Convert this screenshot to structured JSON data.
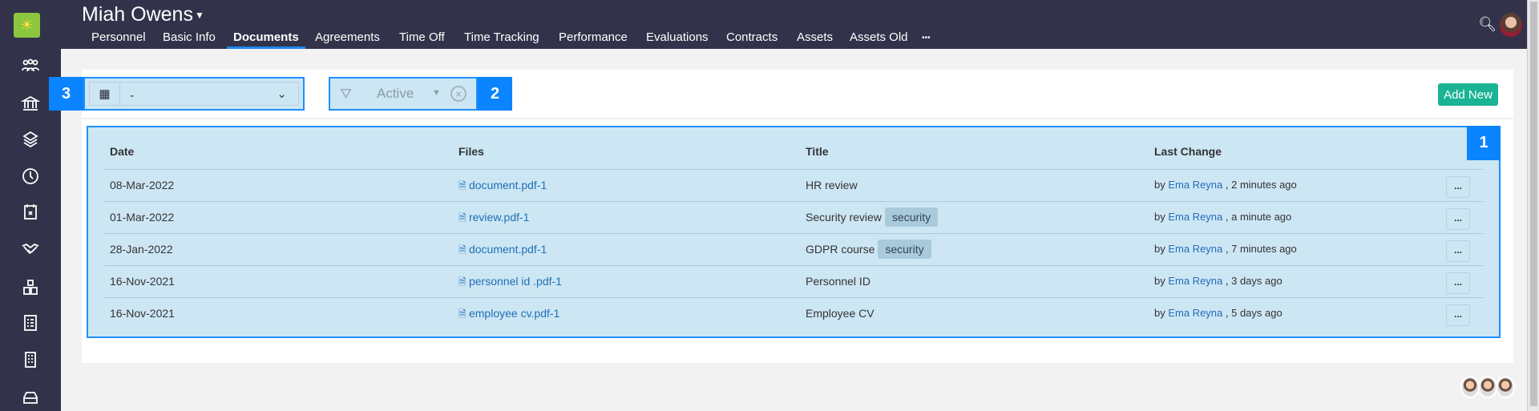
{
  "header": {
    "name": "Miah Owens",
    "tabs": [
      "Personnel",
      "Basic Info",
      "Documents",
      "Agreements",
      "Time Off",
      "Time Tracking",
      "Performance",
      "Evaluations",
      "Contracts",
      "Assets",
      "Assets Old",
      "•••"
    ],
    "active_tab": "Documents"
  },
  "sidebar": {
    "icons": [
      "people-icon",
      "bank-icon",
      "layers-icon",
      "clock-icon",
      "calendar-x-icon",
      "handshake-icon",
      "boxes-icon",
      "checklist-icon",
      "building-icon",
      "inbox-icon"
    ]
  },
  "toolbar": {
    "label3": "3",
    "view_value": "-",
    "label2": "2",
    "filter_value": "Active",
    "add_new": "Add New"
  },
  "table": {
    "label1": "1",
    "columns": [
      "Date",
      "Files",
      "Title",
      "Last Change"
    ],
    "rows": [
      {
        "date": "08-Mar-2022",
        "file": "document.pdf-1",
        "title": "HR review",
        "tag": "",
        "by": "by ",
        "user": "Ema Reyna",
        "when": " , 2 minutes ago",
        "more": "..."
      },
      {
        "date": "01-Mar-2022",
        "file": "review.pdf-1",
        "title": "Security review",
        "tag": "security",
        "by": "by ",
        "user": "Ema Reyna",
        "when": " , a minute ago",
        "more": "..."
      },
      {
        "date": "28-Jan-2022",
        "file": "document.pdf-1",
        "title": "GDPR course",
        "tag": "security",
        "by": "by ",
        "user": "Ema Reyna",
        "when": " , 7 minutes ago",
        "more": "..."
      },
      {
        "date": "16-Nov-2021",
        "file": "personnel id .pdf-1",
        "title": "Personnel ID",
        "tag": "",
        "by": "by ",
        "user": "Ema Reyna",
        "when": " , 3 days ago",
        "more": "..."
      },
      {
        "date": "16-Nov-2021",
        "file": "employee cv.pdf-1",
        "title": "Employee CV",
        "tag": "",
        "by": "by ",
        "user": "Ema Reyna",
        "when": " , 5 days ago",
        "more": "..."
      }
    ]
  },
  "colors": {
    "sidebar": "#32334a",
    "accent": "#0a84ff",
    "add": "#1ab394",
    "highlight": "#cde6f4"
  }
}
